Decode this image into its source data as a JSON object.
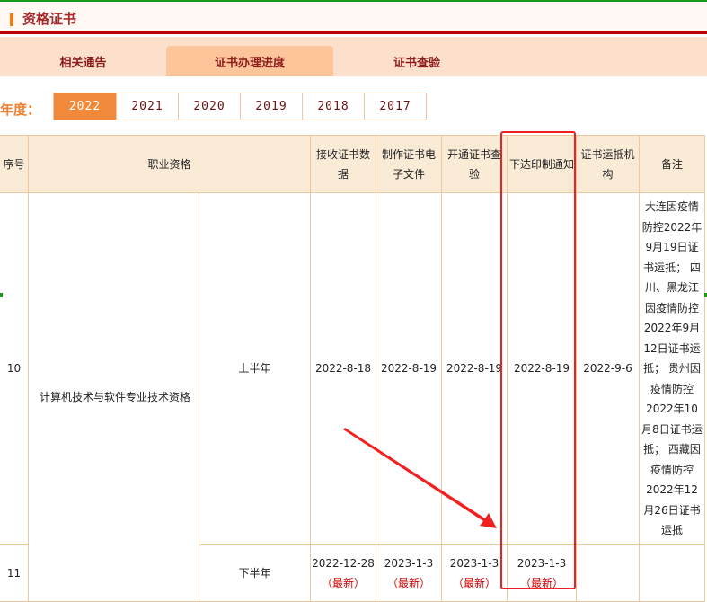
{
  "header": {
    "title": "资格证书"
  },
  "tabs": [
    {
      "label": "相关通告"
    },
    {
      "label": "证书办理进度",
      "active": true
    },
    {
      "label": "证书查验"
    }
  ],
  "year_filter": {
    "label": "年度：",
    "years": [
      "2022",
      "2021",
      "2020",
      "2019",
      "2018",
      "2017"
    ],
    "selected": "2022"
  },
  "table": {
    "headers": [
      "序号",
      "职业资格",
      "接收证书数据",
      "制作证书电子文件",
      "开通证书查验",
      "下达印制通知",
      "证书运抵机构",
      "备注"
    ],
    "qualification": "计算机技术与软件专业技术资格",
    "rows": [
      {
        "no": "10",
        "half": "上半年",
        "receive": "2022-8-18",
        "make": "2022-8-19",
        "open": "2022-8-19",
        "print": "2022-8-19",
        "arrive": "2022-9-6",
        "remark": "大连因疫情防控2022年9月19日证书运抵； 四川、黑龙江因疫情防控2022年9月12日证书运抵； 贵州因疫情防控2022年10月8日证书运抵； 西藏因疫情防控2022年12月26日证书运抵"
      },
      {
        "no": "11",
        "half": "下半年",
        "receive": "2022-12-28",
        "make": "2023-1-3",
        "open": "2023-1-3",
        "print": "2023-1-3",
        "arrive": "",
        "remark": "",
        "latest": "（最新）"
      }
    ]
  },
  "colors": {
    "accent": "#f08a3a",
    "title": "#a52a2a",
    "highlight_box": "#f02020",
    "header_bg": "#faebd7"
  }
}
